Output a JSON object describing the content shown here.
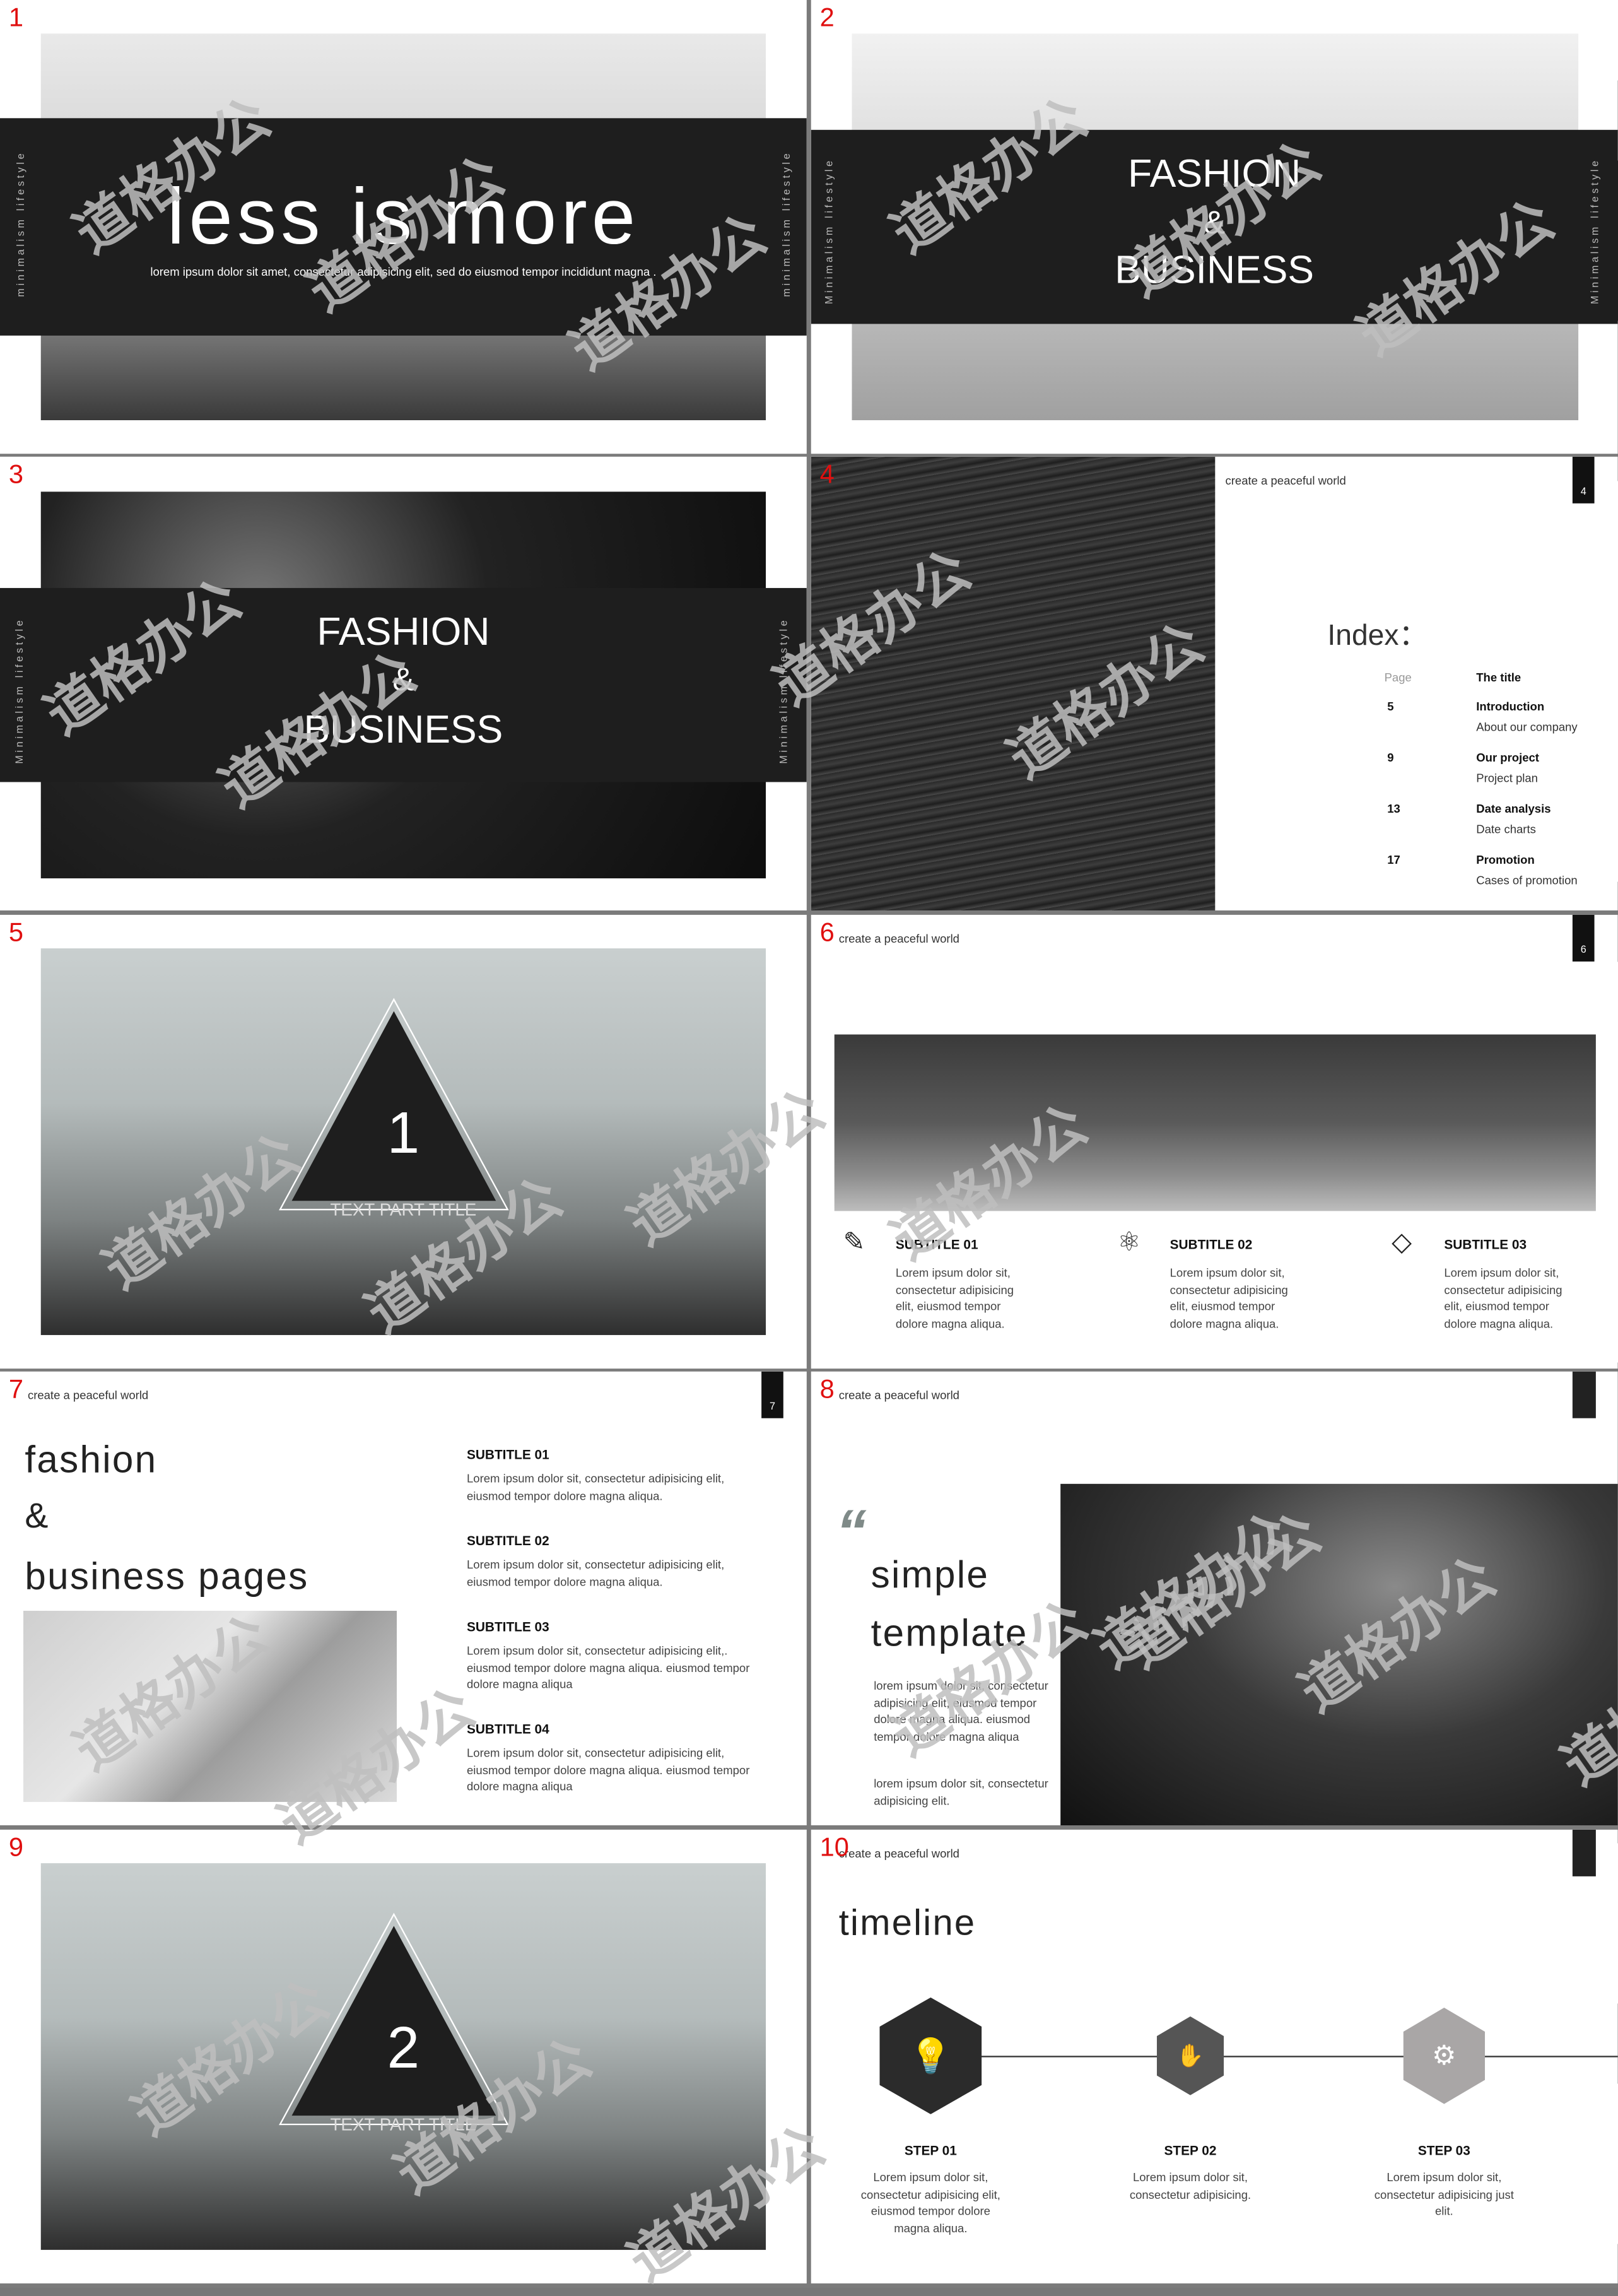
{
  "watermark": "道格办公",
  "slide_numbers": [
    "1",
    "2",
    "3",
    "4",
    "5",
    "6",
    "7",
    "8",
    "9",
    "10"
  ],
  "header_text": "create a peaceful world",
  "vertical_text": "minimalism   lifestyle",
  "vertical_text_cap": "Minimalism   lifestyle",
  "slide1": {
    "title": "less is more",
    "subtitle": "lorem ipsum dolor sit amet, consectetur adipisicing elit, sed do eiusmod tempor incididunt magna ."
  },
  "slide2": {
    "line1": "FASHION",
    "line2": "&",
    "line3": "BUSINESS"
  },
  "slide3": {
    "line1": "FASHION",
    "line2": "&",
    "line3": "BUSINESS"
  },
  "slide4": {
    "page_number": "4",
    "index_title": "Index：",
    "col_page": "Page",
    "col_title": "The title",
    "rows": [
      {
        "page": "5",
        "title": "Introduction",
        "desc": "About our company"
      },
      {
        "page": "9",
        "title": "Our project",
        "desc": "Project plan"
      },
      {
        "page": "13",
        "title": "Date analysis",
        "desc": "Date charts"
      },
      {
        "page": "17",
        "title": "Promotion",
        "desc": "Cases of promotion"
      }
    ]
  },
  "slide5": {
    "number": "1",
    "label": "TEXT PART TITLE"
  },
  "slide6": {
    "page_number": "6",
    "items": [
      {
        "icon": "notepad-pencil-icon",
        "title": "SUBTITLE 01",
        "text": "Lorem ipsum dolor sit, consectetur adipisicing elit, eiusmod tempor dolore magna aliqua."
      },
      {
        "icon": "atom-icon",
        "title": "SUBTITLE 02",
        "text": "Lorem ipsum dolor sit, consectetur adipisicing elit, eiusmod tempor dolore magna aliqua."
      },
      {
        "icon": "diamond-icon",
        "title": "SUBTITLE 03",
        "text": "Lorem ipsum dolor sit, consectetur adipisicing elit, eiusmod tempor dolore magna aliqua."
      }
    ]
  },
  "slide7": {
    "page_number": "7",
    "title1": "fashion",
    "title2": "&",
    "title3": "business pages",
    "items": [
      {
        "title": "SUBTITLE 01",
        "text": "Lorem ipsum dolor sit, consectetur adipisicing elit, eiusmod tempor dolore magna aliqua."
      },
      {
        "title": "SUBTITLE 02",
        "text": "Lorem ipsum dolor sit, consectetur adipisicing elit, eiusmod tempor dolore magna aliqua."
      },
      {
        "title": "SUBTITLE 03",
        "text": "Lorem ipsum dolor sit, consectetur adipisicing elit,. eiusmod tempor dolore magna aliqua. eiusmod tempor dolore magna aliqua"
      },
      {
        "title": "SUBTITLE 04",
        "text": "Lorem ipsum dolor sit, consectetur adipisicing elit, eiusmod tempor dolore magna aliqua. eiusmod tempor dolore magna aliqua"
      }
    ]
  },
  "slide8": {
    "quote": "“",
    "title1": "simple",
    "title2": "template",
    "para1": "lorem ipsum dolor sit, consectetur adipisicing elit, eiusmod tempor dolore magna aliqua. eiusmod tempor dolore magna aliqua",
    "para2": "lorem ipsum dolor sit, consectetur adipisicing elit."
  },
  "slide9": {
    "number": "2",
    "label": "TEXT PART TITLE"
  },
  "slide10": {
    "title": "timeline",
    "steps": [
      {
        "icon": "lightbulb-icon",
        "glyph": "💡",
        "color": "#2b2b2b",
        "title": "STEP 01",
        "text": "Lorem ipsum dolor sit, consectetur adipisicing elit, eiusmod tempor dolore magna aliqua."
      },
      {
        "icon": "handshake-icon",
        "glyph": "✋",
        "color": "#555555",
        "title": "STEP 02",
        "text": "Lorem ipsum dolor sit, consectetur adipisicing."
      },
      {
        "icon": "head-gears-icon",
        "glyph": "⚙",
        "color": "#a9a6a6",
        "title": "STEP 03",
        "text": "Lorem ipsum dolor sit, consectetur adipisicing just elit."
      }
    ]
  }
}
